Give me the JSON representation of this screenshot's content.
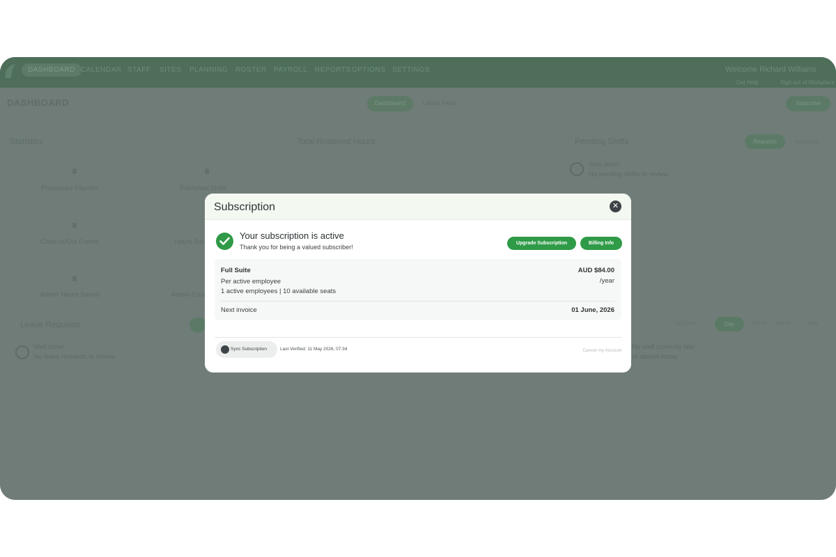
{
  "nav": {
    "items": [
      "DASHBOARD",
      "CALENDAR",
      "STAFF",
      "SITES",
      "PLANNING",
      "ROSTER",
      "PAYROLL",
      "REPORTS",
      "OPTIONS",
      "SETTINGS"
    ],
    "welcome": "Welcome Richard Williams",
    "sub_left": "Get Help",
    "sub_right": "Sign out of Workplace"
  },
  "dashboard": {
    "title": "DASHBOARD",
    "tab_dashboard": "Dashboard",
    "tab_feed": "Latest Feed",
    "top_right_button": "Subscribe",
    "statistics_title": "Statistics",
    "stats": [
      "Processed Payrolls",
      "Published Shifts",
      "Clock-In/Out Events",
      "Hours Saved",
      "Admin Hours Saved",
      "Admin Cost"
    ],
    "rostered_title": "Total Rostered Hours",
    "pending_title": "Pending Shifts",
    "pending_tab_on": "Requests",
    "pending_tab_off": "Accepted",
    "pending_done": "Well done!",
    "pending_note": "No pending shifts to review",
    "leave_title": "Leave Requests",
    "leave_done": "Well done!",
    "leave_note": "No leave requests to review",
    "site_filter": "All Sites",
    "range_tabs": [
      "Day",
      "Week",
      "Month",
      "Year"
    ],
    "right_note1": "No staff currently late",
    "right_note2": "or absent today"
  },
  "modal": {
    "title": "Subscription",
    "status_heading": "Your subscription is active",
    "status_thanks": "Thank you for being a valued subscriber!",
    "upgrade_label": "Upgrade Subscription",
    "billing_label": "Billing Info",
    "plan_name": "Full Suite",
    "plan_price": "AUD $84.00",
    "plan_period": "/year",
    "plan_per": "Per active employee",
    "plan_seats": "1 active employees | 10 available seats",
    "next_invoice_label": "Next invoice",
    "next_invoice_date": "01 June, 2026",
    "sync_label": "Sync Subscription",
    "last_verified": "Last Verified: 11 May 2026, 07:34",
    "cancel_label": "Cancel my Account"
  },
  "colors": {
    "accent": "#2f9a47",
    "overlay": "#707c78",
    "dark_icon": "#3d4346"
  }
}
